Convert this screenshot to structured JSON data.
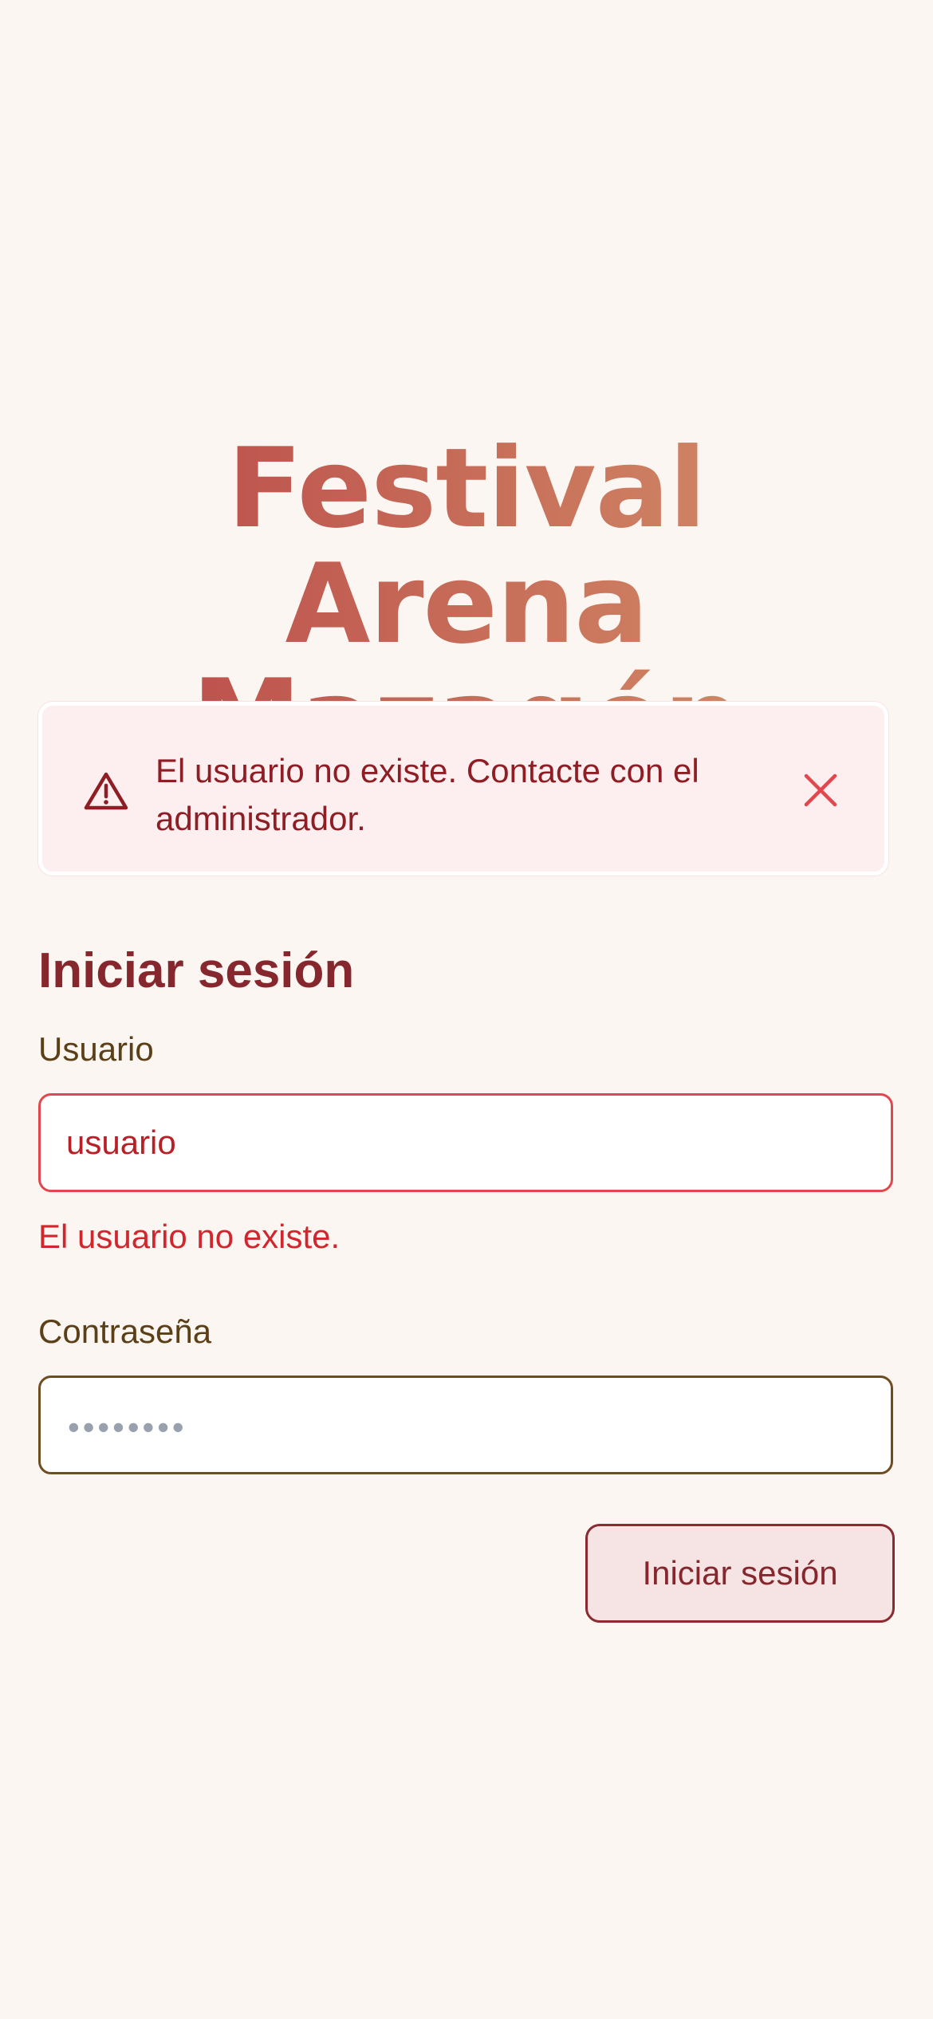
{
  "app": {
    "title_line1": "Festival Arena",
    "title_line2": "Mazagón"
  },
  "alert": {
    "message": "El usuario no existe. Contacte con el administrador.",
    "icon": "warning-triangle-icon",
    "close_icon": "close-x-icon"
  },
  "form": {
    "heading": "Iniciar sesión",
    "username": {
      "label": "Usuario",
      "value": "usuario",
      "error": "El usuario no existe."
    },
    "password": {
      "label": "Contraseña",
      "masked_value": "••••••••"
    },
    "submit_label": "Iniciar sesión"
  },
  "colors": {
    "background": "#fcf6f2",
    "title_gradient_start": "#b84448",
    "title_gradient_end": "#d4946b",
    "alert_bg": "#fdeff0",
    "alert_text": "#8e1d24",
    "error": "#d0262d",
    "heading": "#86272e",
    "label": "#5a3f17"
  }
}
